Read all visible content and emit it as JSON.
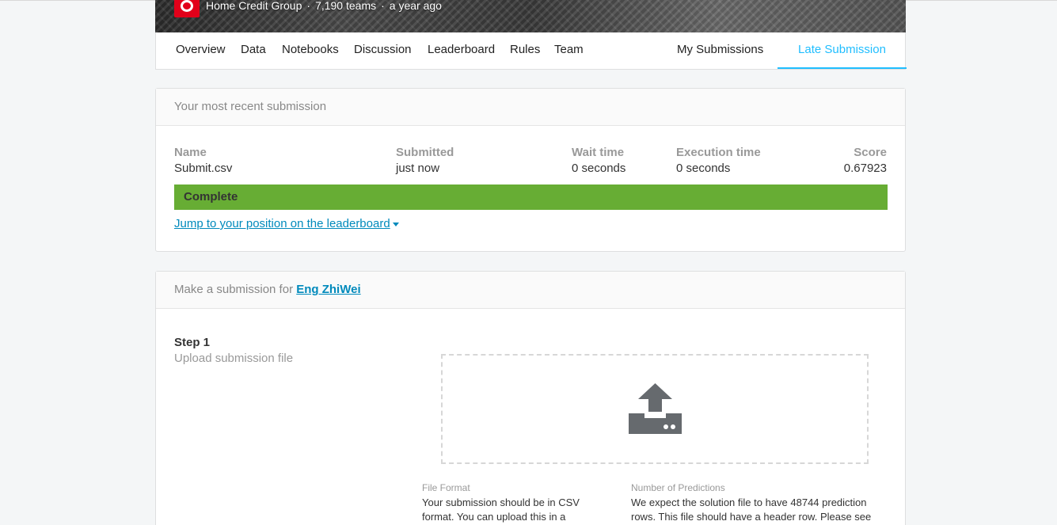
{
  "banner": {
    "organization": "Home Credit Group",
    "separator": "·",
    "teams": "7,190 teams",
    "time": "a year ago"
  },
  "tabs": {
    "overview": "Overview",
    "data": "Data",
    "notebooks": "Notebooks",
    "discussion": "Discussion",
    "leaderboard": "Leaderboard",
    "rules": "Rules",
    "team": "Team",
    "my_submissions": "My Submissions",
    "late_submission": "Late Submission"
  },
  "recent": {
    "header": "Your most recent submission",
    "columns": {
      "name": "Name",
      "submitted": "Submitted",
      "wait_time": "Wait time",
      "execution_time": "Execution time",
      "score": "Score"
    },
    "values": {
      "name": "Submit.csv",
      "submitted": "just now",
      "wait_time": "0 seconds",
      "execution_time": "0 seconds",
      "score": "0.67923"
    },
    "status": "Complete",
    "status_color": "#67ad34",
    "jump_link": "Jump to your position on the leaderboard"
  },
  "make": {
    "header_prefix": "Make a submission for",
    "user": "Eng ZhiWei",
    "step_title": "Step 1",
    "step_subtitle": "Upload submission file",
    "upload_icon": "upload-tray-icon",
    "file_format_label": "File Format",
    "file_format_text": "Your submission should be in CSV format. You can upload this in a",
    "predictions_label": "Number of Predictions",
    "predictions_text": "We expect the solution file to have 48744 prediction rows. This file should have a header row. Please see"
  },
  "colors": {
    "accent": "#20beff",
    "link": "#008abc",
    "brand_red": "#e2001a"
  }
}
